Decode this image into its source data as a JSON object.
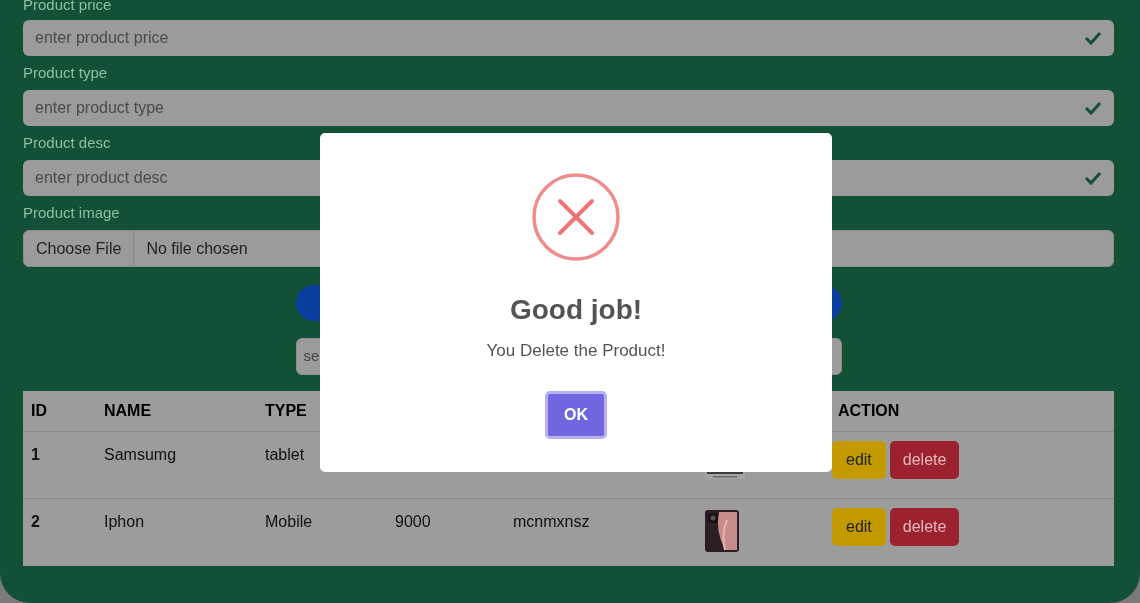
{
  "form": {
    "fields": [
      {
        "label": "Product price",
        "placeholder": "enter product price",
        "valid": true
      },
      {
        "label": "Product type",
        "placeholder": "enter product type",
        "valid": true
      },
      {
        "label": "Product desc",
        "placeholder": "enter product desc",
        "valid": true
      }
    ],
    "image_field": {
      "label": "Product image",
      "button": "Choose File",
      "status": "No file chosen"
    }
  },
  "search": {
    "placeholder": "se"
  },
  "table": {
    "columns": [
      "ID",
      "NAME",
      "TYPE",
      "ACTION"
    ],
    "rows": [
      {
        "id": "1",
        "name": "Samsumg",
        "type": "tablet",
        "edit": "edit",
        "delete": "delete"
      },
      {
        "id": "2",
        "name": "Iphon",
        "type": "Mobile",
        "price": "9000",
        "desc": "mcnmxnsz",
        "edit": "edit",
        "delete": "delete"
      }
    ]
  },
  "dialog": {
    "kind": "error",
    "title": "Good job!",
    "message": "You Delete the Product!",
    "button": "OK"
  }
}
